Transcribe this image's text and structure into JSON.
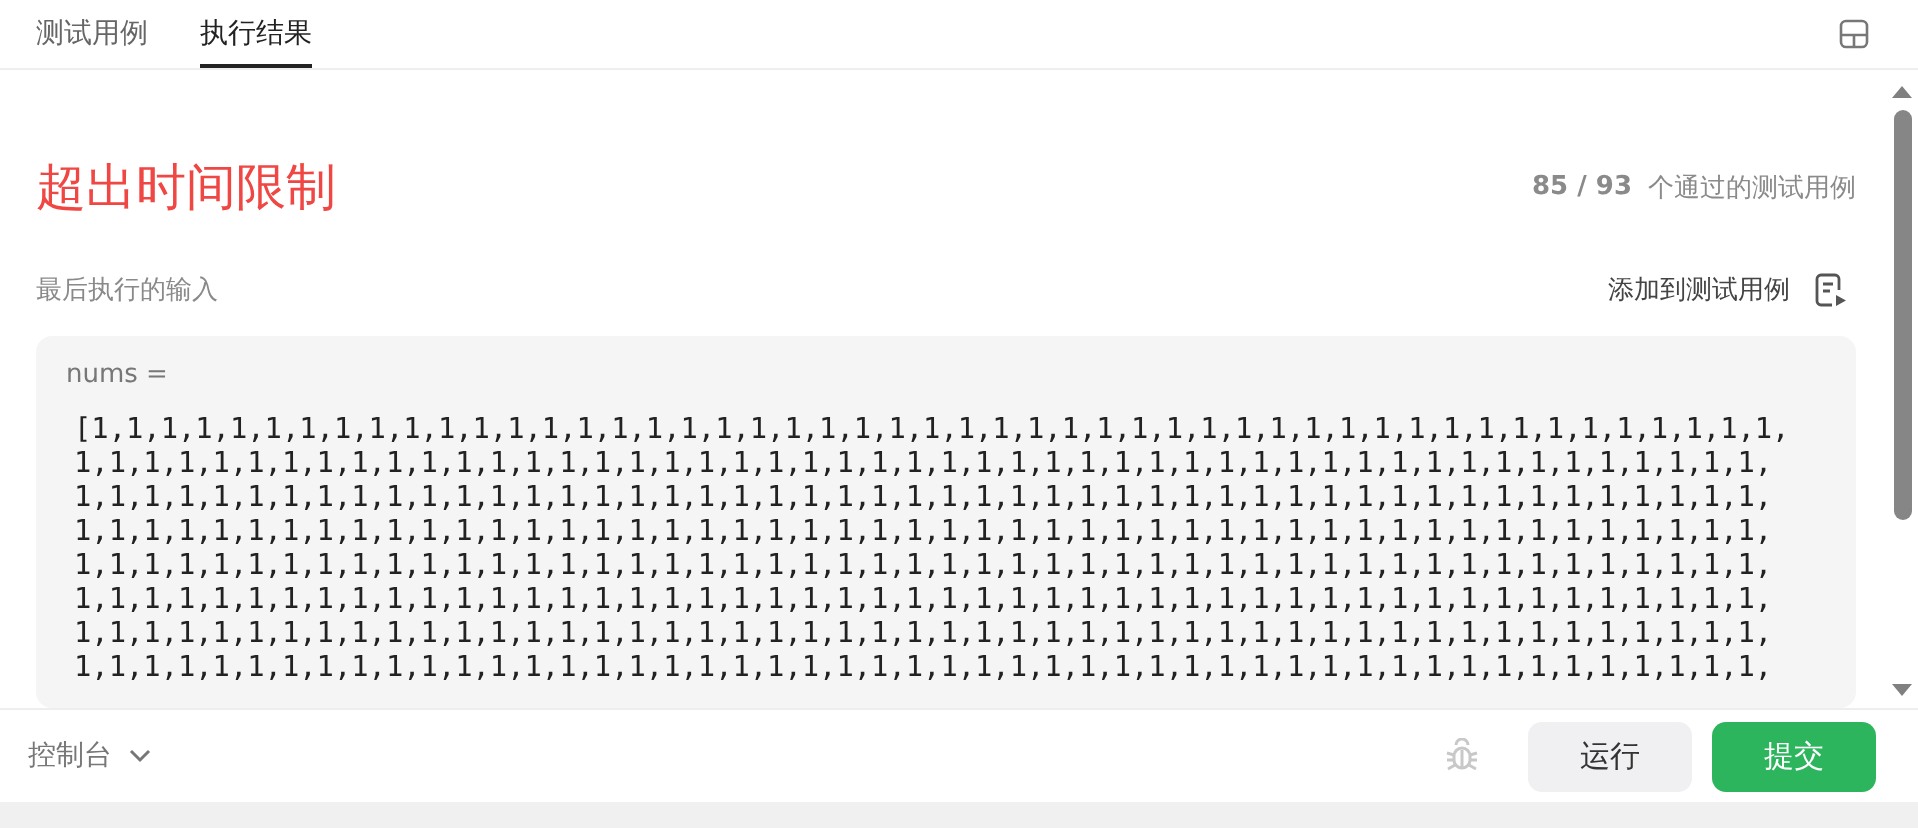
{
  "tabs": [
    {
      "label": "测试用例",
      "selected": false
    },
    {
      "label": "执行结果",
      "selected": true
    }
  ],
  "result": {
    "status": "超出时间限制",
    "passed": "85 / 93",
    "passed_label": "个通过的测试用例"
  },
  "last_input": {
    "label": "最后执行的输入",
    "add_link": "添加到测试用例",
    "var_name": "nums =",
    "lines": [
      "[1,1,1,1,1,1,1,1,1,1,1,1,1,1,1,1,1,1,1,1,1,1,1,1,1,1,1,1,1,1,1,1,1,1,1,1,1,1,1,1,1,1,1,1,1,1,1,1,1,",
      "1,1,1,1,1,1,1,1,1,1,1,1,1,1,1,1,1,1,1,1,1,1,1,1,1,1,1,1,1,1,1,1,1,1,1,1,1,1,1,1,1,1,1,1,1,1,1,1,1,",
      "1,1,1,1,1,1,1,1,1,1,1,1,1,1,1,1,1,1,1,1,1,1,1,1,1,1,1,1,1,1,1,1,1,1,1,1,1,1,1,1,1,1,1,1,1,1,1,1,1,",
      "1,1,1,1,1,1,1,1,1,1,1,1,1,1,1,1,1,1,1,1,1,1,1,1,1,1,1,1,1,1,1,1,1,1,1,1,1,1,1,1,1,1,1,1,1,1,1,1,1,",
      "1,1,1,1,1,1,1,1,1,1,1,1,1,1,1,1,1,1,1,1,1,1,1,1,1,1,1,1,1,1,1,1,1,1,1,1,1,1,1,1,1,1,1,1,1,1,1,1,1,",
      "1,1,1,1,1,1,1,1,1,1,1,1,1,1,1,1,1,1,1,1,1,1,1,1,1,1,1,1,1,1,1,1,1,1,1,1,1,1,1,1,1,1,1,1,1,1,1,1,1,",
      "1,1,1,1,1,1,1,1,1,1,1,1,1,1,1,1,1,1,1,1,1,1,1,1,1,1,1,1,1,1,1,1,1,1,1,1,1,1,1,1,1,1,1,1,1,1,1,1,1,",
      "1,1,1,1,1,1,1,1,1,1,1,1,1,1,1,1,1,1,1,1,1,1,1,1,1,1,1,1,1,1,1,1,1,1,1,1,1,1,1,1,1,1,1,1,1,1,1,1,1,"
    ]
  },
  "footer": {
    "console": "控制台",
    "run": "运行",
    "submit": "提交"
  }
}
